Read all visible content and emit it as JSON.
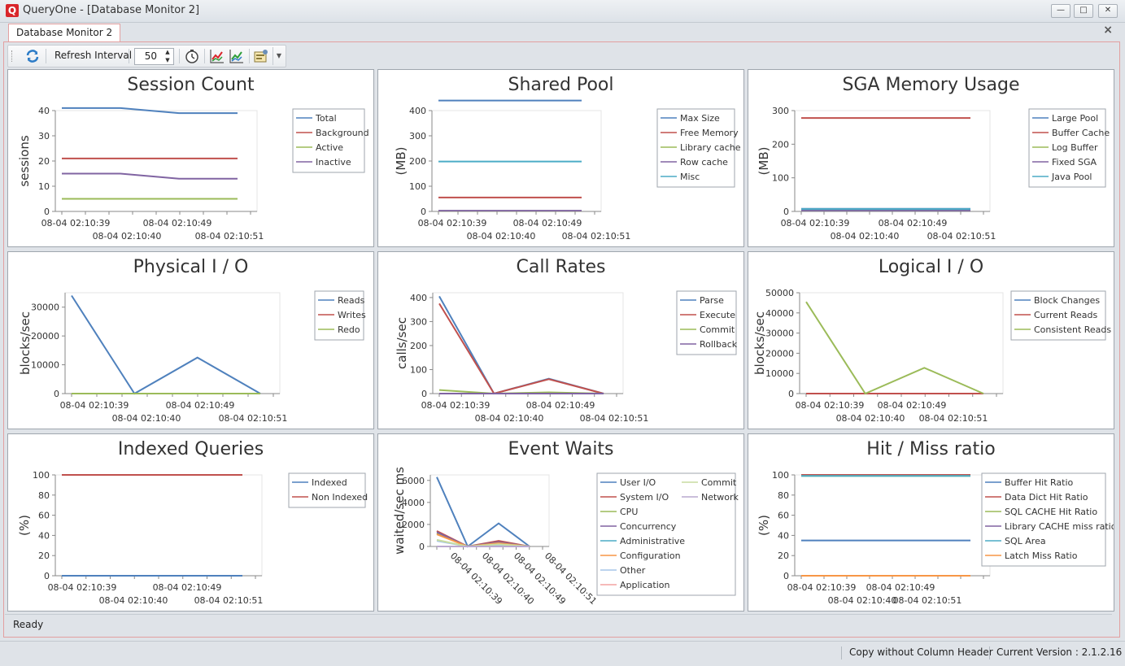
{
  "window": {
    "app_icon": "Q",
    "title": "QueryOne - [Database Monitor 2]",
    "controls": [
      "minimize-icon",
      "maximize-icon",
      "close-icon"
    ]
  },
  "tab": {
    "label": "Database Monitor 2",
    "close": "×"
  },
  "toolbar": {
    "refresh_label": "Refresh Interval",
    "interval_value": "50",
    "icons": [
      "refresh-icon",
      "timer-icon",
      "chart-export-icon",
      "chart-export-alt-icon",
      "settings-icon",
      "dropdown-arrow-icon"
    ]
  },
  "status": {
    "text": "Ready"
  },
  "bottom": {
    "copy_label": "Copy without Column Header",
    "version_label": "Current Version : 2.1.2.16"
  },
  "chart_data": [
    {
      "id": "session-count",
      "title": "Session Count",
      "type": "line",
      "ylabel": "sessions",
      "ylim": [
        0,
        40
      ],
      "yticks": [
        0,
        10,
        20,
        30,
        40
      ],
      "xlabels": [
        "08-04 02:10:39",
        "08-04 02:10:40",
        "08-04 02:10:49",
        "08-04 02:10:51"
      ],
      "series": [
        {
          "name": "Total",
          "color": "#4f81bd",
          "values": [
            41,
            41,
            39,
            39
          ]
        },
        {
          "name": "Background",
          "color": "#c0504d",
          "values": [
            21,
            21,
            21,
            21
          ]
        },
        {
          "name": "Active",
          "color": "#9bbb59",
          "values": [
            5,
            5,
            5,
            5
          ]
        },
        {
          "name": "Inactive",
          "color": "#8064a2",
          "values": [
            15,
            15,
            13,
            13
          ]
        }
      ]
    },
    {
      "id": "shared-pool",
      "title": "Shared Pool",
      "type": "line",
      "ylabel": "(MB)",
      "ylim": [
        0,
        400
      ],
      "yticks": [
        0,
        100,
        200,
        300,
        400
      ],
      "xlabels": [
        "08-04 02:10:39",
        "08-04 02:10:40",
        "08-04 02:10:49",
        "08-04 02:10:51"
      ],
      "series": [
        {
          "name": "Max Size",
          "color": "#4f81bd",
          "values": [
            440,
            440,
            440,
            440
          ]
        },
        {
          "name": "Free Memory",
          "color": "#c0504d",
          "values": [
            55,
            55,
            55,
            55
          ]
        },
        {
          "name": "Library cache",
          "color": "#9bbb59",
          "values": [
            2,
            2,
            2,
            2
          ]
        },
        {
          "name": "Row cache",
          "color": "#8064a2",
          "values": [
            3,
            3,
            3,
            3
          ]
        },
        {
          "name": "Misc",
          "color": "#4bacc6",
          "values": [
            198,
            198,
            198,
            198
          ]
        }
      ]
    },
    {
      "id": "sga-memory",
      "title": "SGA Memory Usage",
      "type": "line",
      "ylabel": "(MB)",
      "ylim": [
        0,
        300
      ],
      "yticks": [
        0,
        100,
        200,
        300
      ],
      "xlabels": [
        "08-04 02:10:39",
        "08-04 02:10:40",
        "08-04 02:10:49",
        "08-04 02:10:51"
      ],
      "series": [
        {
          "name": "Large Pool",
          "color": "#4f81bd",
          "values": [
            8,
            8,
            8,
            8
          ]
        },
        {
          "name": "Buffer Cache",
          "color": "#c0504d",
          "values": [
            278,
            278,
            278,
            278
          ]
        },
        {
          "name": "Log Buffer",
          "color": "#9bbb59",
          "values": [
            5,
            5,
            5,
            5
          ]
        },
        {
          "name": "Fixed SGA",
          "color": "#8064a2",
          "values": [
            3,
            3,
            3,
            3
          ]
        },
        {
          "name": "Java Pool",
          "color": "#4bacc6",
          "values": [
            7,
            7,
            7,
            7
          ]
        }
      ]
    },
    {
      "id": "physical-io",
      "title": "Physical I / O",
      "type": "line",
      "ylabel": "blocks/sec",
      "ylim": [
        0,
        35000
      ],
      "yticks": [
        0,
        10000,
        20000,
        30000
      ],
      "xlabels": [
        "08-04 02:10:39",
        "08-04 02:10:40",
        "08-04 02:10:49",
        "08-04 02:10:51"
      ],
      "series": [
        {
          "name": "Reads",
          "color": "#4f81bd",
          "values": [
            34000,
            0,
            12500,
            0
          ]
        },
        {
          "name": "Writes",
          "color": "#c0504d",
          "values": [
            0,
            0,
            0,
            0
          ]
        },
        {
          "name": "Redo",
          "color": "#9bbb59",
          "values": [
            0,
            0,
            0,
            0
          ]
        }
      ]
    },
    {
      "id": "call-rates",
      "title": "Call Rates",
      "type": "line",
      "ylabel": "calls/sec",
      "ylim": [
        0,
        420
      ],
      "yticks": [
        0,
        100,
        200,
        300,
        400
      ],
      "xlabels": [
        "08-04 02:10:39",
        "08-04 02:10:40",
        "08-04 02:10:49",
        "08-04 02:10:51"
      ],
      "series": [
        {
          "name": "Parse",
          "color": "#4f81bd",
          "values": [
            405,
            0,
            62,
            0
          ]
        },
        {
          "name": "Execute",
          "color": "#c0504d",
          "values": [
            375,
            0,
            60,
            0
          ]
        },
        {
          "name": "Commit",
          "color": "#9bbb59",
          "values": [
            15,
            0,
            5,
            0
          ]
        },
        {
          "name": "Rollback",
          "color": "#8064a2",
          "values": [
            0,
            0,
            0,
            0
          ]
        }
      ]
    },
    {
      "id": "logical-io",
      "title": "Logical I / O",
      "type": "line",
      "ylabel": "blocks/sec",
      "ylim": [
        0,
        50000
      ],
      "yticks": [
        0,
        10000,
        20000,
        30000,
        40000,
        50000
      ],
      "xlabels": [
        "08-04 02:10:39",
        "08-04 02:10:40",
        "08-04 02:10:49",
        "08-04 02:10:51"
      ],
      "series": [
        {
          "name": "Block Changes",
          "color": "#4f81bd",
          "values": [
            0,
            0,
            0,
            0
          ]
        },
        {
          "name": "Current Reads",
          "color": "#c0504d",
          "values": [
            0,
            0,
            0,
            0
          ]
        },
        {
          "name": "Consistent Reads",
          "color": "#9bbb59",
          "values": [
            45500,
            0,
            12800,
            0
          ]
        }
      ]
    },
    {
      "id": "indexed-queries",
      "title": "Indexed Queries",
      "type": "line",
      "ylabel": "(%)",
      "ylim": [
        0,
        100
      ],
      "yticks": [
        0,
        20,
        40,
        60,
        80,
        100
      ],
      "xlabels": [
        "08-04 02:10:39",
        "08-04 02:10:40",
        "08-04 02:10:49",
        "08-04 02:10:51"
      ],
      "series": [
        {
          "name": "Indexed",
          "color": "#4f81bd",
          "values": [
            0,
            0,
            0,
            0
          ]
        },
        {
          "name": "Non Indexed",
          "color": "#c0504d",
          "values": [
            100,
            100,
            100,
            100
          ]
        }
      ]
    },
    {
      "id": "event-waits",
      "title": "Event Waits",
      "type": "line",
      "ylabel": "waited/sec ms",
      "ylim": [
        0,
        6500
      ],
      "yticks": [
        0,
        2000,
        4000,
        6000
      ],
      "xlabels": [
        "08-04 02:10:39",
        "08-04 02:10:40",
        "08-04 02:10:49",
        "08-04 02:10:51"
      ],
      "rotated_xlabels": true,
      "series": [
        {
          "name": "User I/O",
          "color": "#4f81bd",
          "values": [
            6300,
            0,
            2100,
            0
          ]
        },
        {
          "name": "System I/O",
          "color": "#c0504d",
          "values": [
            1400,
            0,
            500,
            0
          ]
        },
        {
          "name": "CPU",
          "color": "#9bbb59",
          "values": [
            1200,
            0,
            350,
            0
          ]
        },
        {
          "name": "Concurrency",
          "color": "#8064a2",
          "values": [
            1300,
            0,
            400,
            0
          ]
        },
        {
          "name": "Administrative",
          "color": "#4bacc6",
          "values": [
            0,
            0,
            0,
            0
          ]
        },
        {
          "name": "Configuration",
          "color": "#f79646",
          "values": [
            1100,
            0,
            300,
            0
          ]
        },
        {
          "name": "Other",
          "color": "#a5c6e8",
          "values": [
            500,
            0,
            150,
            0
          ]
        },
        {
          "name": "Application",
          "color": "#f4a3a2",
          "values": [
            0,
            0,
            0,
            0
          ]
        },
        {
          "name": "Commit",
          "color": "#c9dca0",
          "values": [
            600,
            0,
            200,
            0
          ]
        },
        {
          "name": "Network",
          "color": "#b9a8cf",
          "values": [
            0,
            0,
            0,
            0
          ]
        }
      ]
    },
    {
      "id": "hit-miss",
      "title": "Hit / Miss ratio",
      "type": "line",
      "ylabel": "(%)",
      "ylim": [
        0,
        100
      ],
      "yticks": [
        0,
        20,
        40,
        60,
        80,
        100
      ],
      "xlabels": [
        "08-04 02:10:39",
        "08-04 02:10:40",
        "08-04 02:10:49",
        "08-04 02:10:51"
      ],
      "series": [
        {
          "name": "Buffer Hit Ratio",
          "color": "#4f81bd",
          "values": [
            35,
            35,
            35,
            35
          ]
        },
        {
          "name": "Data Dict Hit Ratio",
          "color": "#c0504d",
          "values": [
            100,
            100,
            100,
            100
          ]
        },
        {
          "name": "SQL CACHE Hit Ratio",
          "color": "#9bbb59",
          "values": [
            99,
            99,
            99,
            99
          ]
        },
        {
          "name": "Library CACHE miss ratio",
          "color": "#8064a2",
          "values": [
            0,
            0,
            0,
            0
          ]
        },
        {
          "name": "SQL Area",
          "color": "#4bacc6",
          "values": [
            99,
            99,
            99,
            99
          ]
        },
        {
          "name": "Latch Miss Ratio",
          "color": "#f79646",
          "values": [
            0,
            0,
            0,
            0
          ]
        }
      ]
    }
  ]
}
